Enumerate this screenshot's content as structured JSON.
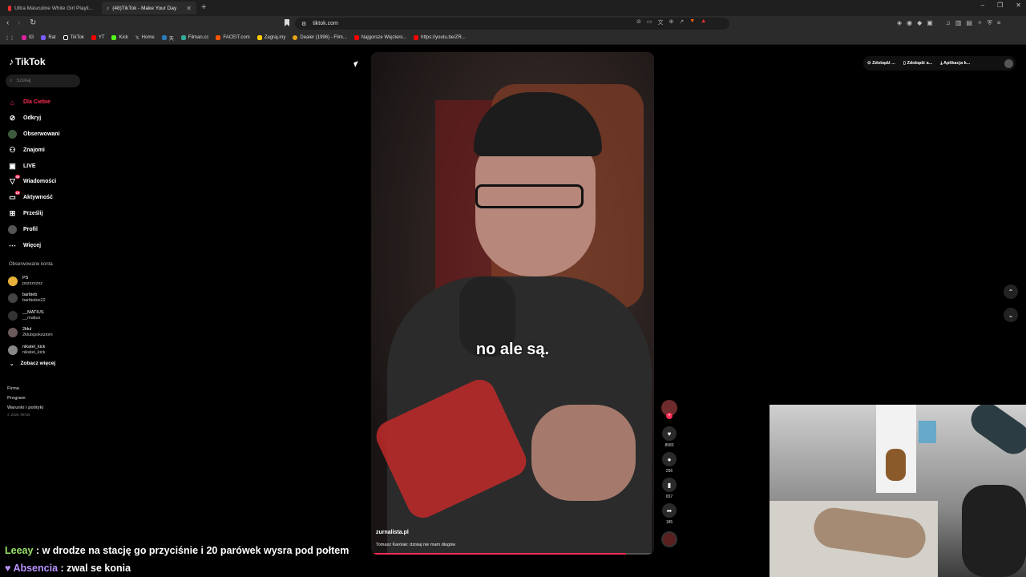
{
  "browser": {
    "tabs": [
      {
        "title": "Ultra Masculine White Girl Playli...",
        "active": false
      },
      {
        "title": "(48)TikTok - Make Your Day",
        "active": true
      }
    ],
    "url": "tiktok.com",
    "bookmarks": [
      "IG",
      "Rat",
      "TikTok",
      "YT",
      "Kick",
      "Home",
      "天",
      "Filman.cc",
      "FACEIT.com",
      "Zagraj.my",
      "Dealer (1996) - Film...",
      "Najgorsze Więzieni...",
      "https://youtu.be/ZR..."
    ]
  },
  "tiktok": {
    "logo": "TikTok",
    "search_placeholder": "Szukaj",
    "nav": [
      {
        "label": "Dla Ciebie",
        "icon": "home-icon",
        "active": true
      },
      {
        "label": "Odkryj",
        "icon": "compass-icon"
      },
      {
        "label": "Obserwowani",
        "icon": "following-icon"
      },
      {
        "label": "Znajomi",
        "icon": "friends-icon"
      },
      {
        "label": "LIVE",
        "icon": "live-icon"
      },
      {
        "label": "Wiadomości",
        "icon": "messages-icon",
        "badge": "36"
      },
      {
        "label": "Aktywność",
        "icon": "activity-icon",
        "badge": "19"
      },
      {
        "label": "Prześlij",
        "icon": "upload-icon"
      },
      {
        "label": "Profil",
        "icon": "profile-icon"
      },
      {
        "label": "Więcej",
        "icon": "more-icon"
      }
    ],
    "following_title": "Obserwowane konta",
    "accounts": [
      {
        "name": "PS",
        "user": "pszszszsz"
      },
      {
        "name": "barbieb",
        "user": "barbiebie22"
      },
      {
        "name": "__MATIUS",
        "user": "__matius"
      },
      {
        "name": "2kłul",
        "user": "2klulspokoziom"
      },
      {
        "name": "nikatel_kick",
        "user": "nikatel_kick"
      }
    ],
    "see_more": "Zobacz więcej",
    "footer": [
      "Firma",
      "Program",
      "Warunki i polityki"
    ],
    "copyright": "© 2025 TikTok",
    "top_right": [
      "Zdobądź ...",
      "Zdobądź a...",
      "Aplikacja k..."
    ],
    "video": {
      "subtitle": "no ale są.",
      "author": "zurnalista.pl",
      "description": "Tomasz Karolak: dzisiaj nie mam długów",
      "progress": 0.9
    },
    "actions": {
      "likes": "8583",
      "comments": "256",
      "saves": "657",
      "shares": "185"
    }
  },
  "stream_chat": [
    {
      "user": "Leeay",
      "message": "w drodze na stację go przyciśnie i 20 parówek wysra pod połtem"
    },
    {
      "user": "Absencia",
      "message": "zwal se konia"
    }
  ],
  "colors": {
    "accent": "#fe2c55",
    "chat_user1": "#9be36b",
    "chat_user2": "#b993ff"
  }
}
